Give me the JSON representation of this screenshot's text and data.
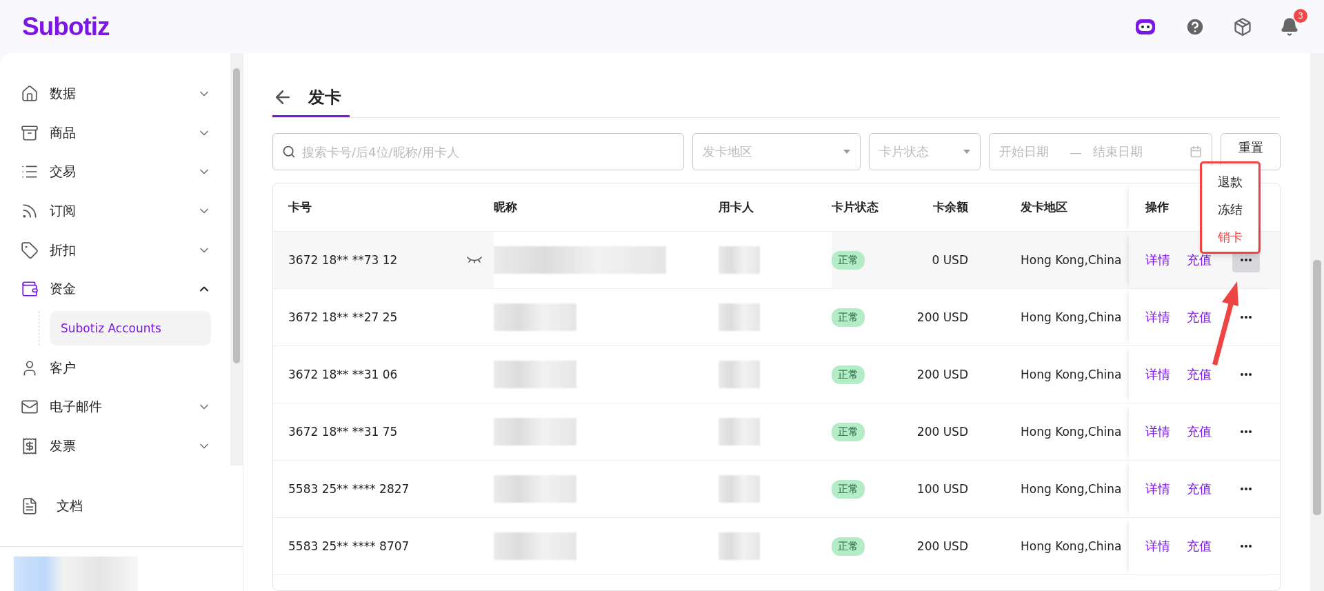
{
  "brand": "Subotiz",
  "header": {
    "notification_count": "3"
  },
  "sidebar": {
    "items": [
      {
        "label": "数据",
        "kind": "group",
        "expanded": false,
        "selected": false
      },
      {
        "label": "商品",
        "kind": "group",
        "expanded": false,
        "selected": false
      },
      {
        "label": "交易",
        "kind": "group",
        "expanded": false,
        "selected": false
      },
      {
        "label": "订阅",
        "kind": "group",
        "expanded": false,
        "selected": false
      },
      {
        "label": "折扣",
        "kind": "group",
        "expanded": false,
        "selected": false
      },
      {
        "label": "资金",
        "kind": "group",
        "expanded": true,
        "selected": true,
        "children": [
          {
            "label": "Subotiz Accounts",
            "selected": true
          }
        ]
      },
      {
        "label": "客户",
        "kind": "link",
        "selected": false
      },
      {
        "label": "电子邮件",
        "kind": "group",
        "expanded": false,
        "selected": false
      },
      {
        "label": "发票",
        "kind": "group",
        "expanded": false,
        "selected": false
      }
    ],
    "footer_item": {
      "label": "文档"
    }
  },
  "page": {
    "title": "发卡"
  },
  "filters": {
    "search_placeholder": "搜索卡号/后4位/昵称/用卡人",
    "region_placeholder": "发卡地区",
    "status_placeholder": "卡片状态",
    "start_placeholder": "开始日期",
    "range_separator": "—",
    "end_placeholder": "结束日期",
    "reset": "重置"
  },
  "table": {
    "columns": [
      "卡号",
      "昵称",
      "用卡人",
      "卡片状态",
      "卡余额",
      "发卡地区",
      "操作"
    ],
    "rows": [
      {
        "card": "3672 18** **73 12",
        "status": "正常",
        "balance": "0 USD",
        "region": "Hong Kong,China",
        "actions": [
          "详情",
          "充值"
        ],
        "hovered": true,
        "menu_open": true
      },
      {
        "card": "3672 18** **27 25",
        "status": "正常",
        "balance": "200 USD",
        "region": "Hong Kong,China",
        "actions": [
          "详情",
          "充值"
        ],
        "hovered": false,
        "menu_open": false
      },
      {
        "card": "3672 18** **31 06",
        "status": "正常",
        "balance": "200 USD",
        "region": "Hong Kong,China",
        "actions": [
          "详情",
          "充值"
        ],
        "hovered": false,
        "menu_open": false
      },
      {
        "card": "3672 18** **31 75",
        "status": "正常",
        "balance": "200 USD",
        "region": "Hong Kong,China",
        "actions": [
          "详情",
          "充值"
        ],
        "hovered": false,
        "menu_open": false
      },
      {
        "card": "5583 25** **** 2827",
        "status": "正常",
        "balance": "100 USD",
        "region": "Hong Kong,China",
        "actions": [
          "详情",
          "充值"
        ],
        "hovered": false,
        "menu_open": false
      },
      {
        "card": "5583 25** **** 8707",
        "status": "正常",
        "balance": "200 USD",
        "region": "Hong Kong,China",
        "actions": [
          "详情",
          "充值"
        ],
        "hovered": false,
        "menu_open": false
      }
    ]
  },
  "menu": {
    "items": [
      {
        "label": "退款",
        "kind": "normal"
      },
      {
        "label": "冻结",
        "kind": "normal"
      },
      {
        "label": "销卡",
        "kind": "danger"
      }
    ]
  }
}
